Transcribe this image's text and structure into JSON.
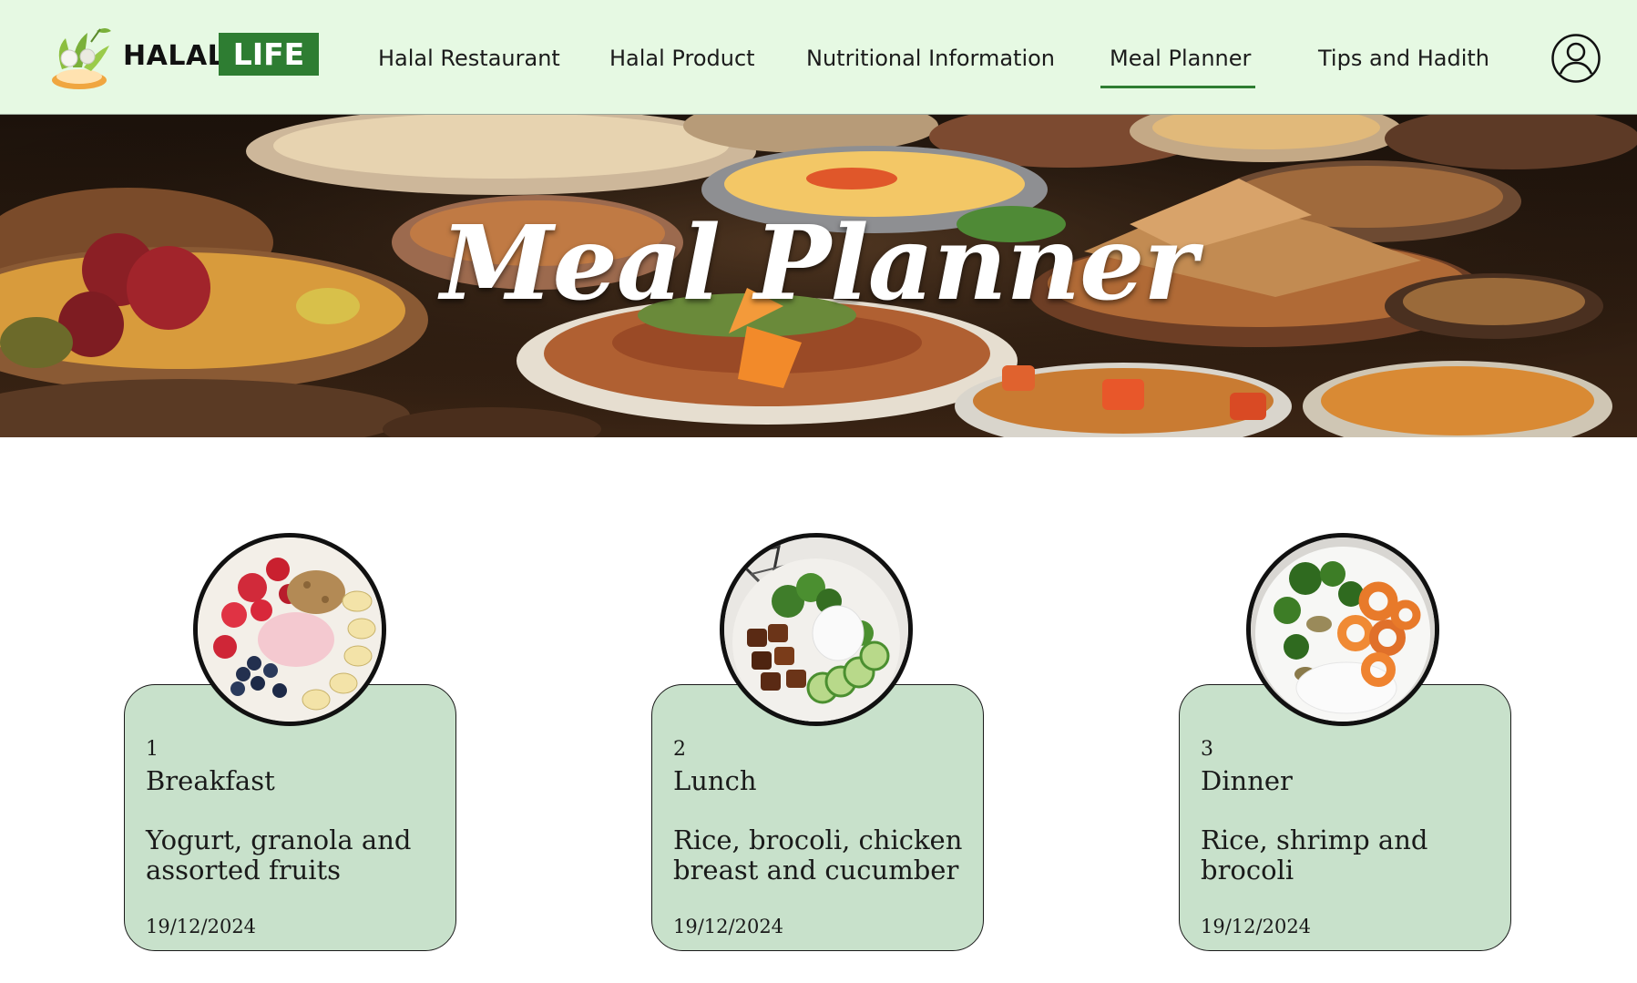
{
  "header": {
    "logo": {
      "word1": "HALAL",
      "word2": "LIFE",
      "icon": "halal-life-logo-icon",
      "accent": "#2e7d32"
    },
    "nav": [
      {
        "label": "Halal Restaurant",
        "active": false
      },
      {
        "label": "Halal Product",
        "active": false
      },
      {
        "label": "Nutritional Information",
        "active": false
      },
      {
        "label": "Meal Planner",
        "active": true
      },
      {
        "label": "Tips and Hadith",
        "active": false
      }
    ],
    "profile_icon": "user-circle-icon",
    "background": "#e6f9e3"
  },
  "hero": {
    "title": "Meal Planner",
    "image": "food-spread-banner"
  },
  "meals": [
    {
      "number": "1",
      "meal": "Breakfast",
      "description": "Yogurt, granola and assorted fruits",
      "date": "19/12/2024",
      "image": "yogurt-bowl-photo"
    },
    {
      "number": "2",
      "meal": "Lunch",
      "description": "Rice, brocoli, chicken breast and cucumber",
      "date": "19/12/2024",
      "image": "chicken-rice-bowl-photo"
    },
    {
      "number": "3",
      "meal": "Dinner",
      "description": "Rice, shrimp and brocoli",
      "date": "19/12/2024",
      "image": "shrimp-rice-bowl-photo"
    }
  ],
  "colors": {
    "card_background": "#c8e1cb",
    "nav_active_underline": "#2e7d32"
  }
}
